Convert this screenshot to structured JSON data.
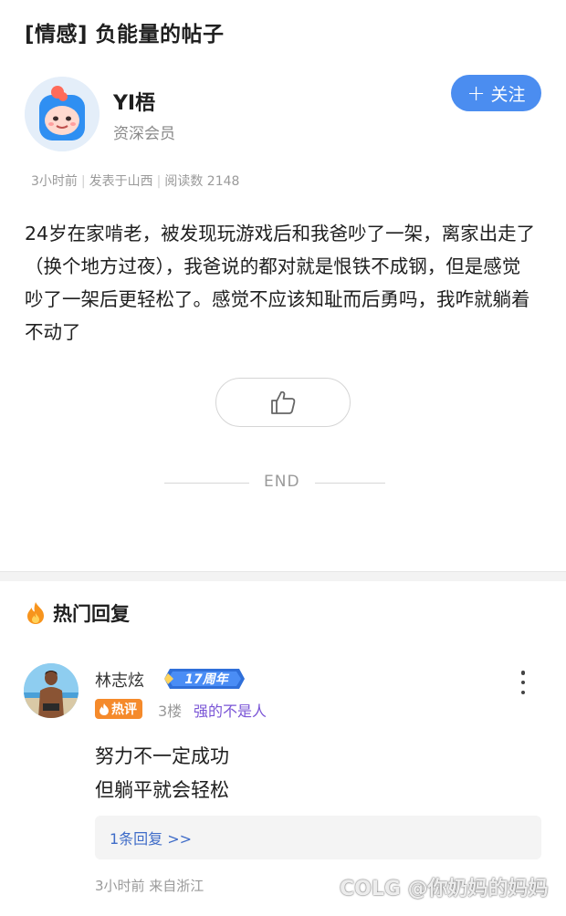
{
  "post": {
    "title": "[情感] 负能量的帖子",
    "author": {
      "name": "YI梧",
      "level": "资深会员"
    },
    "follow_label": "关注",
    "meta": {
      "time": "3小时前",
      "location": "发表于山西",
      "reads": "阅读数 2148"
    },
    "content": "24岁在家啃老，被发现玩游戏后和我爸吵了一架，离家出走了（换个地方过夜），我爸说的都对就是恨铁不成钢，但是感觉吵了一架后更轻松了。感觉不应该知耻而后勇吗，我咋就躺着不动了",
    "end_label": "END"
  },
  "hot_replies": {
    "title": "热门回复",
    "comment": {
      "user": "林志炫",
      "anniversary_badge": "17周年",
      "hot_badge": "热评",
      "floor": "3楼",
      "quote": "强的不是人",
      "text_lines": [
        "努力不一定成功",
        "但躺平就会轻松"
      ],
      "reply_link": "1条回复 >>",
      "meta": "3小时前 来自浙江"
    }
  },
  "watermark": "COLG @你奶妈的妈妈",
  "colors": {
    "accent": "#4b8df0",
    "hot_orange": "#f58a2b",
    "quote_purple": "#7a55d6",
    "link_blue": "#3f6cc8"
  }
}
